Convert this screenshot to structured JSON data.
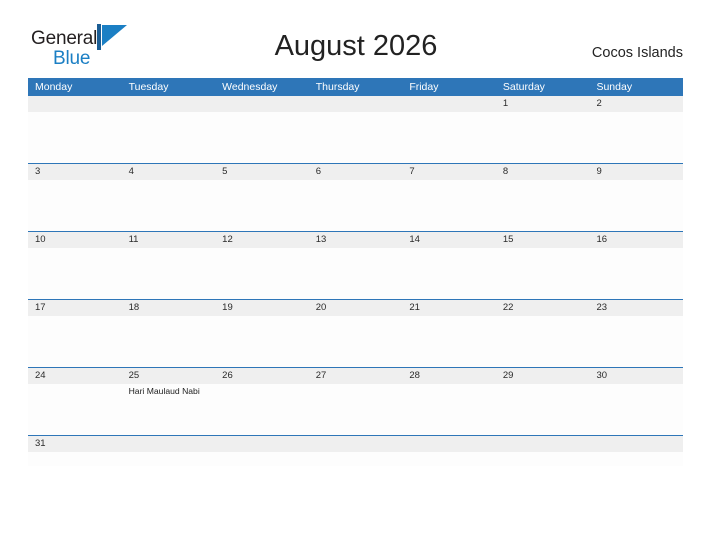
{
  "brand": {
    "name_part1": "General",
    "name_part2": "Blue",
    "logo_icon": "flag-triangle-icon",
    "color_dark": "#231f20",
    "color_blue": "#1b7fc4"
  },
  "header": {
    "title": "August 2026",
    "location": "Cocos Islands"
  },
  "theme": {
    "header_blue": "#2e76b8",
    "band_gray": "#efefef",
    "rule_blue": "#2e76b8",
    "text_dark": "#222222",
    "background": "#ffffff"
  },
  "calendar": {
    "weekdays": [
      "Monday",
      "Tuesday",
      "Wednesday",
      "Thursday",
      "Friday",
      "Saturday",
      "Sunday"
    ],
    "weeks": [
      {
        "days": [
          {
            "num": "",
            "events": []
          },
          {
            "num": "",
            "events": []
          },
          {
            "num": "",
            "events": []
          },
          {
            "num": "",
            "events": []
          },
          {
            "num": "",
            "events": []
          },
          {
            "num": "1",
            "events": []
          },
          {
            "num": "2",
            "events": []
          }
        ]
      },
      {
        "days": [
          {
            "num": "3",
            "events": []
          },
          {
            "num": "4",
            "events": []
          },
          {
            "num": "5",
            "events": []
          },
          {
            "num": "6",
            "events": []
          },
          {
            "num": "7",
            "events": []
          },
          {
            "num": "8",
            "events": []
          },
          {
            "num": "9",
            "events": []
          }
        ]
      },
      {
        "days": [
          {
            "num": "10",
            "events": []
          },
          {
            "num": "11",
            "events": []
          },
          {
            "num": "12",
            "events": []
          },
          {
            "num": "13",
            "events": []
          },
          {
            "num": "14",
            "events": []
          },
          {
            "num": "15",
            "events": []
          },
          {
            "num": "16",
            "events": []
          }
        ]
      },
      {
        "days": [
          {
            "num": "17",
            "events": []
          },
          {
            "num": "18",
            "events": []
          },
          {
            "num": "19",
            "events": []
          },
          {
            "num": "20",
            "events": []
          },
          {
            "num": "21",
            "events": []
          },
          {
            "num": "22",
            "events": []
          },
          {
            "num": "23",
            "events": []
          }
        ]
      },
      {
        "days": [
          {
            "num": "24",
            "events": []
          },
          {
            "num": "25",
            "events": [
              "Hari Maulaud Nabi"
            ]
          },
          {
            "num": "26",
            "events": []
          },
          {
            "num": "27",
            "events": []
          },
          {
            "num": "28",
            "events": []
          },
          {
            "num": "29",
            "events": []
          },
          {
            "num": "30",
            "events": []
          }
        ]
      },
      {
        "days": [
          {
            "num": "31",
            "events": []
          },
          {
            "num": "",
            "events": []
          },
          {
            "num": "",
            "events": []
          },
          {
            "num": "",
            "events": []
          },
          {
            "num": "",
            "events": []
          },
          {
            "num": "",
            "events": []
          },
          {
            "num": "",
            "events": []
          }
        ]
      }
    ]
  }
}
